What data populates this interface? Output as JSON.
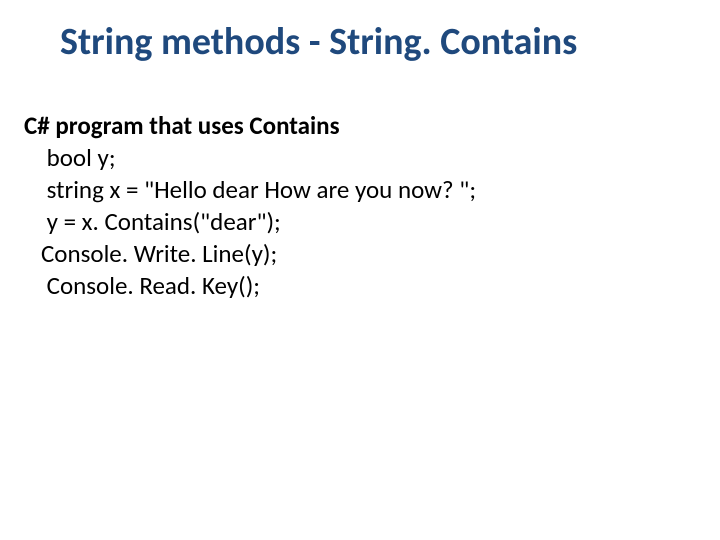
{
  "title": "String methods - String. Contains",
  "section_heading": "C# program that uses Contains",
  "code": {
    "l1": "    bool y;",
    "l2": "    string x = \"Hello dear How are you now? \";",
    "l3": "    y = x. Contains(\"dear\");",
    "l4": "   Console. Write. Line(y);",
    "l5": "    Console. Read. Key();"
  }
}
